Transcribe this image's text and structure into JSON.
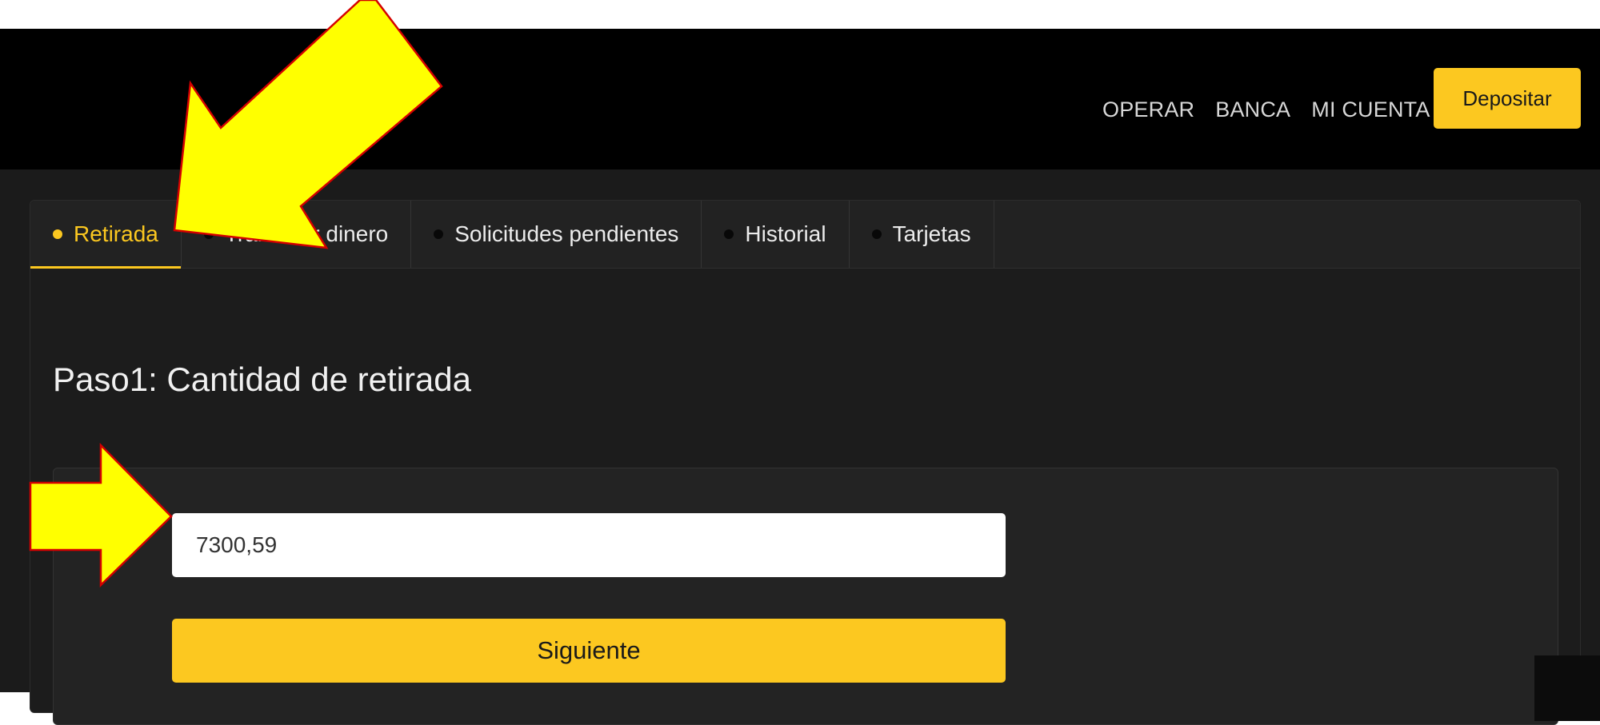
{
  "header": {
    "nav": [
      "OPERAR",
      "BANCA",
      "MI CUENTA"
    ],
    "deposit_label": "Depositar"
  },
  "tabs": [
    {
      "label": "Retirada",
      "active": true
    },
    {
      "label": "Transferir dinero",
      "active": false
    },
    {
      "label": "Solicitudes pendientes",
      "active": false
    },
    {
      "label": "Historial",
      "active": false
    },
    {
      "label": "Tarjetas",
      "active": false
    }
  ],
  "main": {
    "step_title": "Paso1: Cantidad de retirada",
    "amount_value": "7300,59",
    "next_label": "Siguiente"
  },
  "annotations": [
    {
      "type": "arrow",
      "points_to": "tab-retirada",
      "color": "#ffff00",
      "outline": "#d40000"
    },
    {
      "type": "arrow",
      "points_to": "amount-input",
      "color": "#ffff00",
      "outline": "#d40000"
    }
  ],
  "colors": {
    "accent": "#fcc820",
    "header_bg": "#000000",
    "page_bg": "#1b1b1b",
    "annotation_arrow": "#ffff00"
  }
}
